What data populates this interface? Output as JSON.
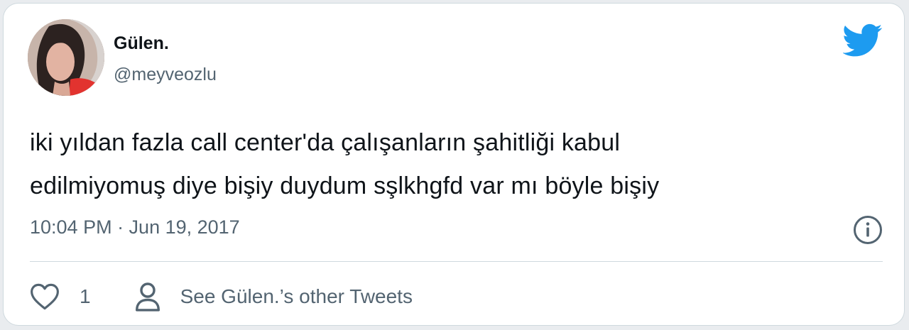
{
  "author": {
    "display_name": "Gülen.",
    "handle": "@meyveozlu",
    "avatar_icon": "profile-photo"
  },
  "tweet": {
    "line1": "iki yıldan fazla call center'da çalışanların şahitliği kabul",
    "line2": "edilmiyomuş diye bişiy duydum sşlkhgfd var mı böyle bişiy",
    "timestamp": "10:04 PM · Jun 19, 2017"
  },
  "actions": {
    "like_icon": "heart-icon",
    "like_count": "1",
    "profile_icon": "person-icon",
    "other_tweets_label": "See Gülen.’s other Tweets"
  },
  "icons": {
    "brand": "twitter-bird-icon",
    "info": "info-icon"
  },
  "colors": {
    "brand_blue": "#1d9bf0",
    "text_primary": "#0f1419",
    "text_secondary": "#536471",
    "border": "#cfd9de"
  }
}
